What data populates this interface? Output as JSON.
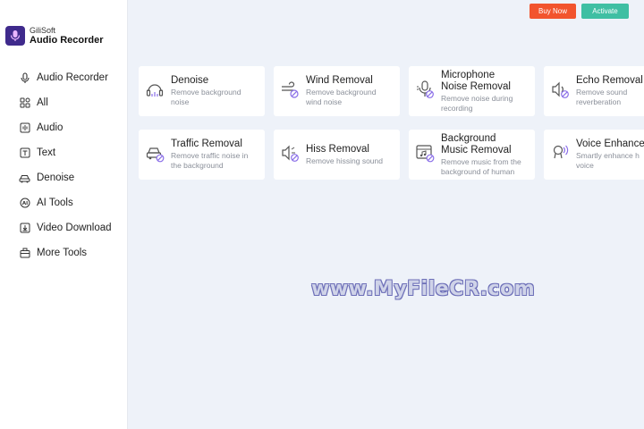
{
  "app": {
    "brand_small": "GiliSoft",
    "brand_name": "Audio Recorder"
  },
  "header": {
    "buy_label": "Buy Now",
    "activate_label": "Activate"
  },
  "sidebar": {
    "items": [
      {
        "label": "Audio Recorder",
        "icon": "microphone-icon"
      },
      {
        "label": "All",
        "icon": "grid-icon"
      },
      {
        "label": "Audio",
        "icon": "audio-icon"
      },
      {
        "label": "Text",
        "icon": "text-icon"
      },
      {
        "label": "Denoise",
        "icon": "car-icon"
      },
      {
        "label": "AI Tools",
        "icon": "ai-icon"
      },
      {
        "label": "Video Download",
        "icon": "download-icon"
      },
      {
        "label": "More Tools",
        "icon": "toolbox-icon"
      }
    ]
  },
  "tools": [
    {
      "title": "Denoise",
      "desc": "Remove background\nnoise",
      "icon": "denoise-icon"
    },
    {
      "title": "Wind Removal",
      "desc": "Remove background\nwind noise",
      "icon": "wind-icon"
    },
    {
      "title": "Microphone\nNoise Removal",
      "desc": "Remove noise during\nrecording",
      "icon": "microphone-noise-icon"
    },
    {
      "title": "Echo Removal",
      "desc": "Remove sound\nreverberation",
      "icon": "echo-icon"
    },
    {
      "title": "Traffic Removal",
      "desc": "Remove traffic noise in\nthe background",
      "icon": "traffic-icon"
    },
    {
      "title": "Hiss Removal",
      "desc": "Remove hissing sound",
      "icon": "hiss-icon"
    },
    {
      "title": "Background\nMusic Removal",
      "desc": "Remove music from the\nbackground of human",
      "icon": "music-removal-icon"
    },
    {
      "title": "Voice Enhance",
      "desc": "Smartly enhance h\nvoice",
      "icon": "voice-enhance-icon"
    }
  ],
  "watermark": "www.MyFileCR.com",
  "colors": {
    "accent": "#8a6ee8",
    "buy": "#f2542d",
    "activate": "#3fbfa3",
    "logo": "#3f2a8c"
  }
}
